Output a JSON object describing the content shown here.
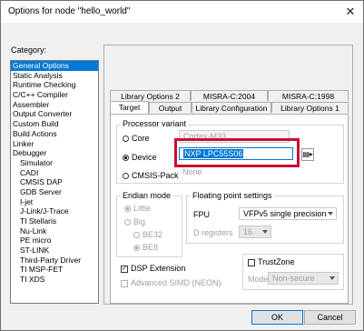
{
  "window": {
    "title": "Options for node \"hello_world\"",
    "close_glyph": "✕"
  },
  "category": {
    "label": "Category:",
    "items": [
      "General Options",
      "Static Analysis",
      "Runtime Checking",
      "C/C++ Compiler",
      "Assembler",
      "Output Converter",
      "Custom Build",
      "Build Actions",
      "Linker",
      "Debugger",
      "Simulator",
      "CADI",
      "CMSIS DAP",
      "GDB Server",
      "I-jet",
      "J-Link/J-Trace",
      "TI Stellaris",
      "Nu-Link",
      "PE micro",
      "ST-LINK",
      "Third-Party Driver",
      "TI MSP-FET",
      "TI XDS"
    ],
    "selected": 0
  },
  "tabs_back": [
    "Library Options 2",
    "MISRA-C:2004",
    "MISRA-C:1998"
  ],
  "tabs_front": [
    "Target",
    "Output",
    "Library Configuration",
    "Library Options 1"
  ],
  "processor": {
    "group_label": "Processor variant",
    "core_label": "Core",
    "core_value": "Cortex-M33",
    "device_label": "Device",
    "device_value": "NXP LPC55S06",
    "cmsis_label": "CMSIS-Pack",
    "cmsis_value": "None",
    "icon": "device-select-icon"
  },
  "endian": {
    "group_label": "Endian mode",
    "little": "Little",
    "big": "Big",
    "be32": "BE32",
    "be8": "BE8"
  },
  "fpu": {
    "group_label": "Floating point settings",
    "fpu_label": "FPU",
    "fpu_value": "VFPv5 single precision",
    "dregs_label": "D registers",
    "dregs_value": "16"
  },
  "dsp": {
    "label": "DSP Extension",
    "checked": "✓"
  },
  "simd": {
    "label": "Advanced SIMD (NEON)"
  },
  "trustzone": {
    "label": "TrustZone",
    "mode_label": "Mode",
    "mode_value": "Non-secure"
  },
  "buttons": {
    "ok": "OK",
    "cancel": "Cancel"
  },
  "colors": {
    "accent": "#0078d7",
    "highlight": "#c8102e"
  }
}
